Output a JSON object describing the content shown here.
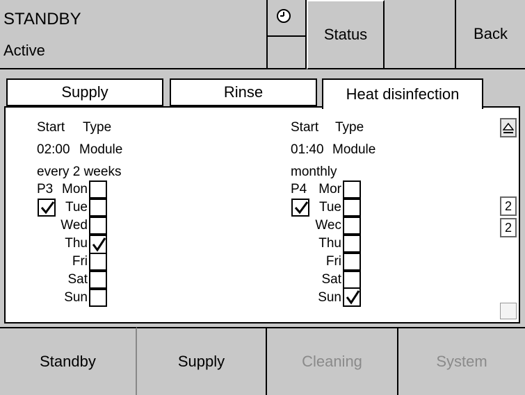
{
  "header": {
    "mode": "STANDBY",
    "state": "Active",
    "status_label": "Status",
    "back_label": "Back"
  },
  "tabs": [
    {
      "label": "Supply",
      "active": false
    },
    {
      "label": "Rinse",
      "active": false
    },
    {
      "label": "Heat disinfection",
      "active": true
    }
  ],
  "schedules": [
    {
      "start_label": "Start",
      "type_label": "Type",
      "start_time": "02:00",
      "type": "Module",
      "interval": "every 2 weeks",
      "program": "P3",
      "enabled": true,
      "days": [
        {
          "label": "Mon",
          "checked": false
        },
        {
          "label": "Tue",
          "checked": false
        },
        {
          "label": "Wed",
          "checked": false
        },
        {
          "label": "Thu",
          "checked": true
        },
        {
          "label": "Fri",
          "checked": false
        },
        {
          "label": "Sat",
          "checked": false
        },
        {
          "label": "Sun",
          "checked": false
        }
      ]
    },
    {
      "start_label": "Start",
      "type_label": "Type",
      "start_time": "01:40",
      "type": "Module",
      "interval": "monthly",
      "program": "P4",
      "enabled": true,
      "days": [
        {
          "label": "Mor",
          "checked": false
        },
        {
          "label": "Tue",
          "checked": false
        },
        {
          "label": "Wec",
          "checked": false
        },
        {
          "label": "Thu",
          "checked": false
        },
        {
          "label": "Fri",
          "checked": false
        },
        {
          "label": "Sat",
          "checked": false
        },
        {
          "label": "Sun",
          "checked": true
        }
      ]
    }
  ],
  "scrollbar": {
    "page_current": "2",
    "page_total": "2"
  },
  "bottom_nav": [
    {
      "label": "Standby",
      "enabled": true
    },
    {
      "label": "Supply",
      "enabled": true
    },
    {
      "label": "Cleaning",
      "enabled": false
    },
    {
      "label": "System",
      "enabled": false
    }
  ]
}
